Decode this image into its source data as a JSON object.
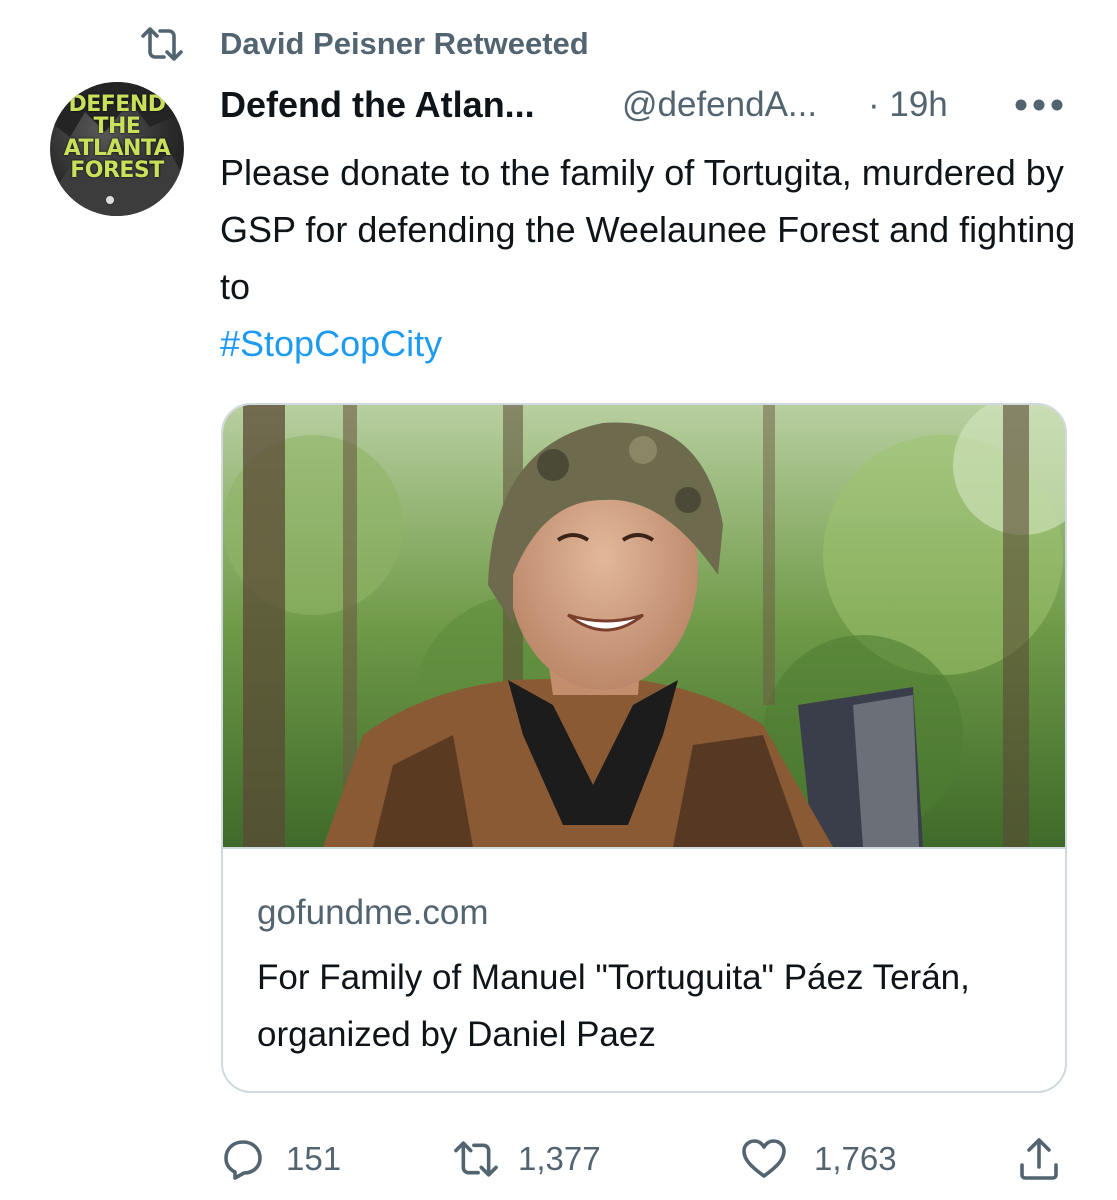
{
  "retweet_context": {
    "label": "David Peisner Retweeted",
    "icon": "retweet-icon"
  },
  "author": {
    "avatar_text": [
      "DEFEND",
      "THE",
      "ATLANTA",
      "FOREST"
    ],
    "display_name": "Defend the Atlan...",
    "handle": "@defendA...",
    "time": "· 19h"
  },
  "tweet": {
    "text": "Please donate to the family of Tortugita, murdered by GSP for defending the Weelaunee Forest and fighting to",
    "hashtag": "#StopCopCity"
  },
  "card": {
    "domain": "gofundme.com",
    "title": "For Family of Manuel \"Tortuguita\" Páez Terán, organized by Daniel Paez"
  },
  "actions": {
    "replies": "151",
    "retweets": "1,377",
    "likes": "1,763"
  },
  "colors": {
    "text_primary": "#0f1419",
    "text_secondary": "#536471",
    "link": "#1d9bf0",
    "border": "#cfd9de"
  }
}
